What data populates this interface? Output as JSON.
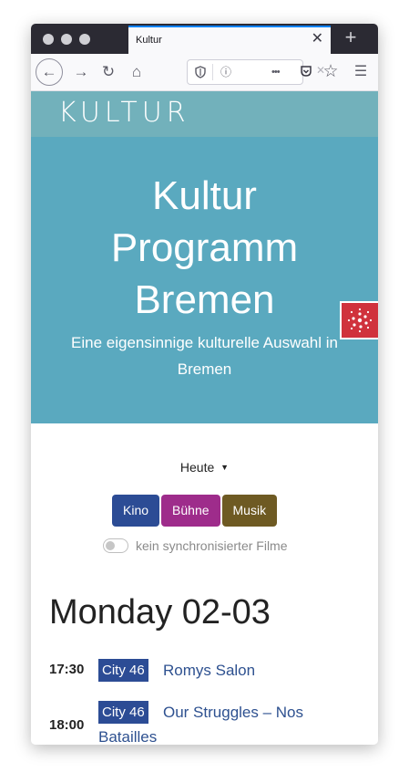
{
  "browser": {
    "tab_title": "Kultur",
    "tab_close": "✕",
    "new_tab": "+",
    "back": "←",
    "forward": "→",
    "reload": "↻",
    "home": "⌂",
    "url_info": "ⓘ",
    "url_more": "•••",
    "url_clear": "✕",
    "bookmark": "☆",
    "menu": "☰"
  },
  "site": {
    "logo": "KULTUR",
    "hero_title_lines": [
      "Kultur",
      "Programm",
      "Bremen"
    ],
    "hero_subtitle": "Eine eigensinnige kulturelle Auswahl in Bremen"
  },
  "controls": {
    "day_selector": "Heute",
    "filters": [
      {
        "label": "Kino",
        "color": "#2c4c95"
      },
      {
        "label": "Bühne",
        "color": "#9e2c8b"
      },
      {
        "label": "Musik",
        "color": "#6e5a23"
      }
    ],
    "sync_toggle_label": "kein synchronisierter Filme",
    "sync_toggle_on": false
  },
  "program": {
    "day_heading": "Monday 02-03",
    "events": [
      {
        "time": "17:30",
        "venue": "City 46",
        "title": "Romys Salon"
      },
      {
        "time": "18:00",
        "venue": "City 46",
        "title_line1": "Our Struggles – Nos",
        "title_line2": "Batailles"
      }
    ]
  },
  "colors": {
    "nav_bg": "#72b1bb",
    "hero_bg": "#5aa9bf",
    "link": "#2e5190",
    "badge": "#d0323c"
  }
}
